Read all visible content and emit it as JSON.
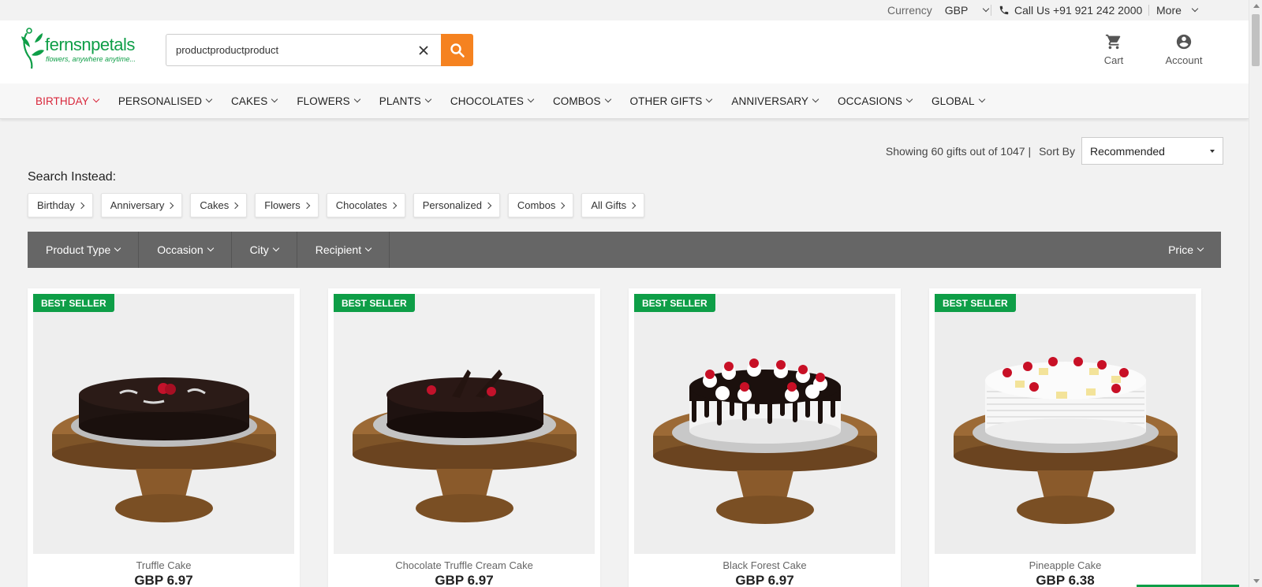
{
  "topbar": {
    "currency_label": "Currency",
    "currency_value": "GBP",
    "call_text": "Call Us +91 921 242 2000",
    "more_label": "More"
  },
  "header": {
    "logo_name": "fernsnpetals",
    "logo_tagline": "flowers, anywhere anytime...",
    "search_value": "productproductproduct",
    "cart_label": "Cart",
    "account_label": "Account"
  },
  "nav": {
    "items": [
      {
        "label": "BIRTHDAY"
      },
      {
        "label": "PERSONALISED"
      },
      {
        "label": "CAKES"
      },
      {
        "label": "FLOWERS"
      },
      {
        "label": "PLANTS"
      },
      {
        "label": "CHOCOLATES"
      },
      {
        "label": "COMBOS"
      },
      {
        "label": "OTHER GIFTS"
      },
      {
        "label": "ANNIVERSARY"
      },
      {
        "label": "OCCASIONS"
      },
      {
        "label": "GLOBAL"
      }
    ]
  },
  "results": {
    "summary": "Showing 60 gifts out of 1047 |",
    "sort_label": "Sort By",
    "sort_value": "Recommended"
  },
  "search_instead": {
    "title": "Search Instead:",
    "chips": [
      "Birthday",
      "Anniversary",
      "Cakes",
      "Flowers",
      "Chocolates",
      "Personalized",
      "Combos",
      "All Gifts"
    ]
  },
  "filters": {
    "product_type": "Product Type",
    "occasion": "Occasion",
    "city": "City",
    "recipient": "Recipient",
    "price": "Price"
  },
  "products": [
    {
      "badge": "BEST SELLER",
      "name": "Truffle Cake",
      "price": "GBP  6.97"
    },
    {
      "badge": "BEST SELLER",
      "name": "Chocolate Truffle Cream Cake",
      "price": "GBP  6.97"
    },
    {
      "badge": "BEST SELLER",
      "name": "Black Forest Cake",
      "price": "GBP  6.97"
    },
    {
      "badge": "BEST SELLER",
      "name": "Pineapple Cake",
      "price": "GBP  6.38"
    }
  ],
  "colors": {
    "brand_green": "#0e9e47",
    "search_orange": "#f58220",
    "nav_active_red": "#d8263a",
    "filter_bar_gray": "#666666"
  }
}
